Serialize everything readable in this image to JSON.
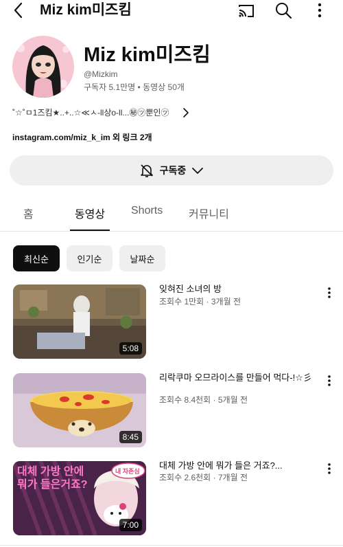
{
  "topbar": {
    "title": "Miz kim미즈킴",
    "icons": [
      "back-arrow-icon",
      "cast-icon",
      "search-icon",
      "more-vert-icon"
    ]
  },
  "channel": {
    "name": "Miz kim미즈킴",
    "handle": "@Mizkim",
    "stats": "구독자 5.1만명 • 동영상 50개",
    "description": "˚☆˚ㅁ1즈킴★..+..☆≪ㅅ-ll상o-ll...㊙㋡뿐인㋡",
    "links": "instagram.com/miz_k_im 외 링크 2개",
    "subscribe_label": "구독중"
  },
  "tabs": [
    {
      "label": "홈",
      "active": false
    },
    {
      "label": "동영상",
      "active": true
    },
    {
      "label": "Shorts",
      "active": false
    },
    {
      "label": "커뮤니티",
      "active": false
    }
  ],
  "chips": [
    {
      "label": "최신순",
      "active": true
    },
    {
      "label": "인기순",
      "active": false
    },
    {
      "label": "날짜순",
      "active": false
    }
  ],
  "videos": [
    {
      "title": "잊혀진 소녀의 방",
      "meta": "조회수 1만회 · 3개월 전",
      "duration": "5:08"
    },
    {
      "title": "리락쿠마 오므라이스를 만들어 먹다-!☆彡",
      "meta": "조회수 8.4천회 · 5개월 전",
      "duration": "8:45"
    },
    {
      "title": "대체 가방 안에 뭐가 들은 거죠?...",
      "meta": "조회수 2.6천회 · 7개월 전",
      "duration": "7:00"
    }
  ],
  "thumb_texts": {
    "v3_main": "대체 가방 안에 뭐가 들은거죠?",
    "v3_bubble": "내 자존심"
  }
}
